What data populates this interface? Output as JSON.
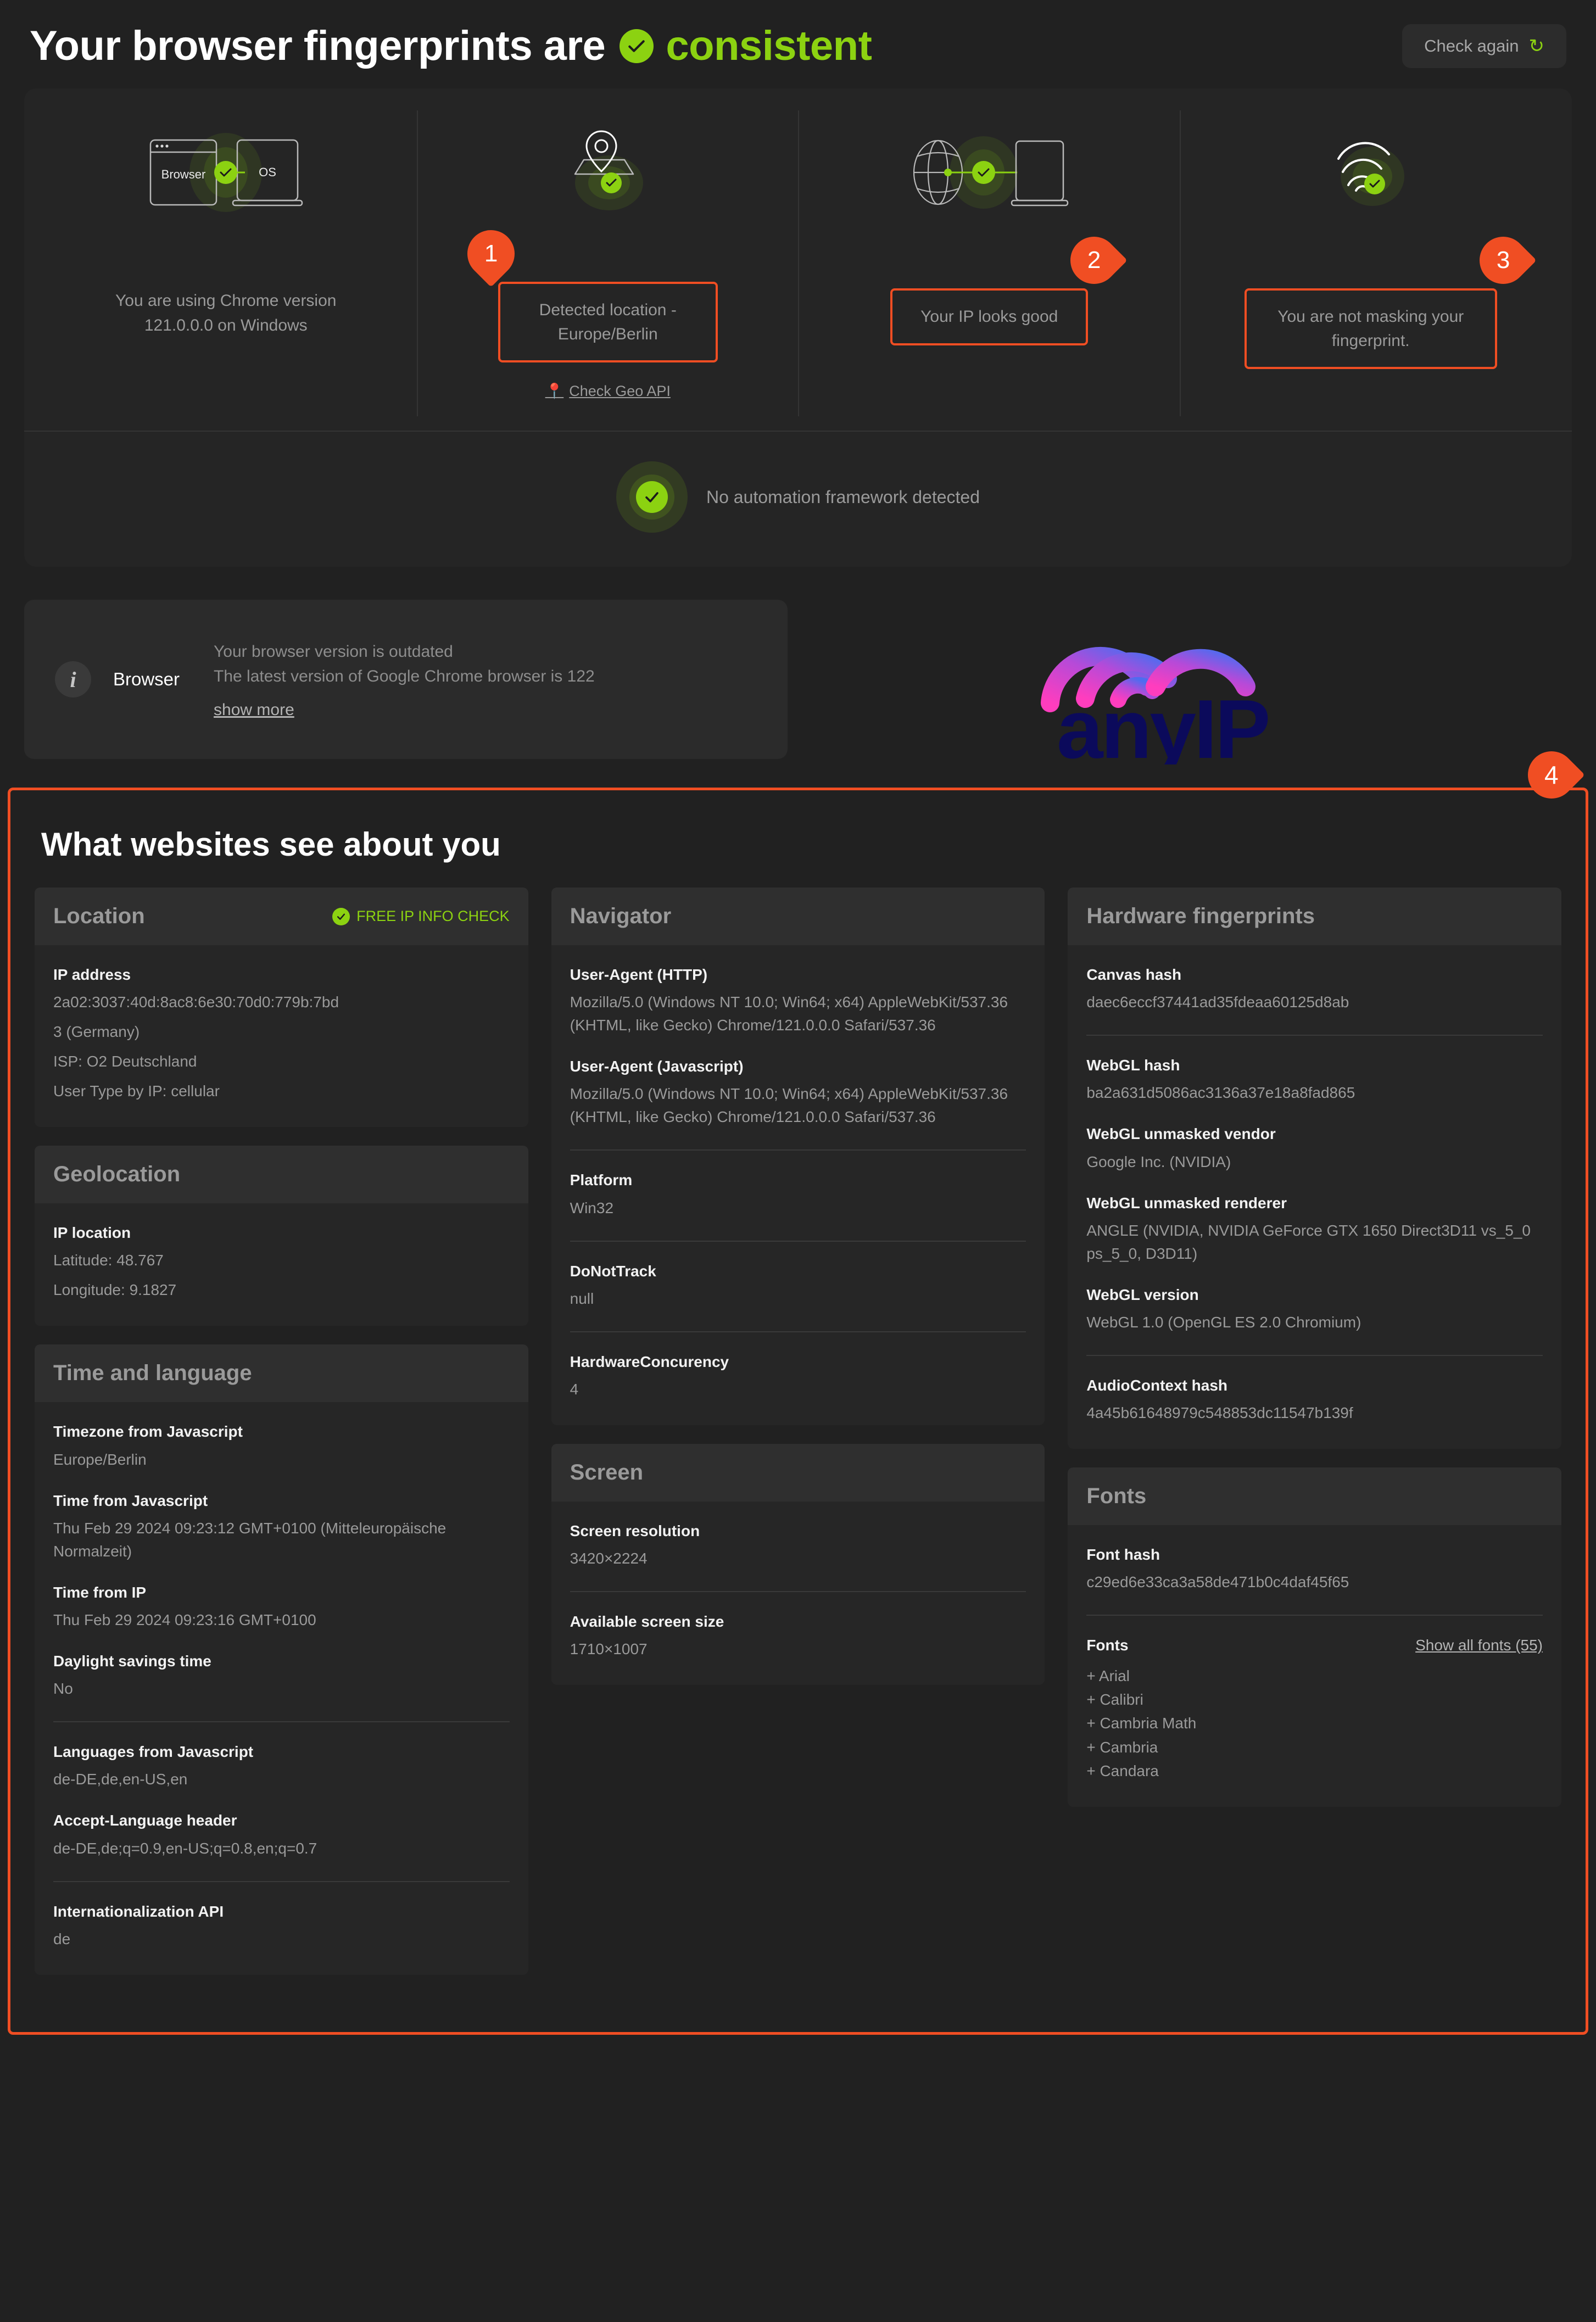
{
  "header": {
    "title_prefix": "Your browser fingerprints are",
    "verdict": "consistent",
    "verdict_color": "#8CD211",
    "check_again_label": "Check again",
    "refresh_icon": "refresh-icon"
  },
  "status": {
    "cells": [
      {
        "icon": "browser-os-icon",
        "text": "You are using Chrome version 121.0.0.0 on Windows",
        "highlighted": false,
        "pin": null
      },
      {
        "icon": "location-pin-icon",
        "text": "Detected location - Europe/Berlin",
        "highlighted": true,
        "pin": "1",
        "link": "Check Geo API"
      },
      {
        "icon": "globe-device-icon",
        "text": "Your IP looks good",
        "highlighted": true,
        "pin": "2"
      },
      {
        "icon": "fingerprint-icon",
        "text": "You are not masking your fingerprint.",
        "highlighted": true,
        "pin": "3"
      }
    ],
    "automation": "No automation framework detected"
  },
  "browser_notice": {
    "label": "Browser",
    "line1": "Your browser version is outdated",
    "line2": "The latest version of Google Chrome browser is 122",
    "show_more": "show more",
    "info_icon_glyph": "i"
  },
  "logo": {
    "text": "anyIP",
    "wordmark_color": "#0B0A5B",
    "arc_from": "#FF3DBE",
    "arc_to": "#4E6CF0"
  },
  "panel": {
    "pin": "4",
    "title": "What websites see about you",
    "accent": "#F04E23"
  },
  "sections": {
    "location": {
      "title": "Location",
      "badge": "FREE IP INFO CHECK",
      "rows": [
        {
          "key": "IP address",
          "value": "2a02:3037:40d:8ac8:6e30:70d0:779b:7bd3 (Germany)\nISP: O2 Deutschland\nUser Type by IP: cellular"
        }
      ],
      "ip_address_key": "IP address",
      "ip_address_line1": "2a02:3037:40d:8ac8:6e30:70d0:779b:7bd",
      "ip_address_line2": "3 (Germany)",
      "isp": "ISP: O2 Deutschland",
      "user_type": "User Type by IP: cellular"
    },
    "geolocation": {
      "title": "Geolocation",
      "key": "IP location",
      "latitude": "Latitude: 48.767",
      "longitude": "Longitude: 9.1827"
    },
    "time_language": {
      "title": "Time and language",
      "rows": [
        {
          "key": "Timezone from Javascript",
          "value": "Europe/Berlin"
        },
        {
          "key": "Time from Javascript",
          "value": "Thu Feb 29 2024 09:23:12 GMT+0100 (Mitteleuropäische Normalzeit)"
        },
        {
          "key": "Time from IP",
          "value": "Thu Feb 29 2024 09:23:16 GMT+0100"
        },
        {
          "key": "Daylight savings time",
          "value": "No"
        },
        {
          "key": "Languages from Javascript",
          "value": "de-DE,de,en-US,en"
        },
        {
          "key": "Accept-Language header",
          "value": "de-DE,de;q=0.9,en-US;q=0.8,en;q=0.7"
        },
        {
          "key": "Internationalization API",
          "value": "de"
        }
      ]
    },
    "navigator": {
      "title": "Navigator",
      "rows": [
        {
          "key": "User-Agent (HTTP)",
          "value": "Mozilla/5.0 (Windows NT 10.0; Win64; x64) AppleWebKit/537.36 (KHTML, like Gecko) Chrome/121.0.0.0 Safari/537.36"
        },
        {
          "key": "User-Agent (Javascript)",
          "value": "Mozilla/5.0 (Windows NT 10.0; Win64; x64) AppleWebKit/537.36 (KHTML, like Gecko) Chrome/121.0.0.0 Safari/537.36"
        },
        {
          "key": "Platform",
          "value": "Win32"
        },
        {
          "key": "DoNotTrack",
          "value": "null"
        },
        {
          "key": "HardwareConcurency",
          "value": "4"
        }
      ]
    },
    "screen": {
      "title": "Screen",
      "rows": [
        {
          "key": "Screen resolution",
          "value": "3420×2224"
        },
        {
          "key": "Available screen size",
          "value": "1710×1007"
        }
      ]
    },
    "hardware": {
      "title": "Hardware fingerprints",
      "rows": [
        {
          "key": "Canvas hash",
          "value": "daec6eccf37441ad35fdeaa60125d8ab"
        },
        {
          "key": "WebGL hash",
          "value": "ba2a631d5086ac3136a37e18a8fad865"
        },
        {
          "key": "WebGL unmasked vendor",
          "value": "Google Inc. (NVIDIA)"
        },
        {
          "key": "WebGL unmasked renderer",
          "value": "ANGLE (NVIDIA, NVIDIA GeForce GTX 1650 Direct3D11 vs_5_0 ps_5_0, D3D11)"
        },
        {
          "key": "WebGL version",
          "value": "WebGL 1.0 (OpenGL ES 2.0 Chromium)"
        },
        {
          "key": "AudioContext hash",
          "value": "4a45b61648979c548853dc11547b139f"
        }
      ]
    },
    "fonts": {
      "title": "Fonts",
      "hash_key": "Font hash",
      "hash_value": "c29ed6e33ca3a58de471b0c4daf45f65",
      "list_key": "Fonts",
      "show_all": "Show all fonts (55)",
      "list": [
        "+ Arial",
        "+ Calibri",
        "+ Cambria Math",
        "+ Cambria",
        "+ Candara"
      ]
    }
  }
}
